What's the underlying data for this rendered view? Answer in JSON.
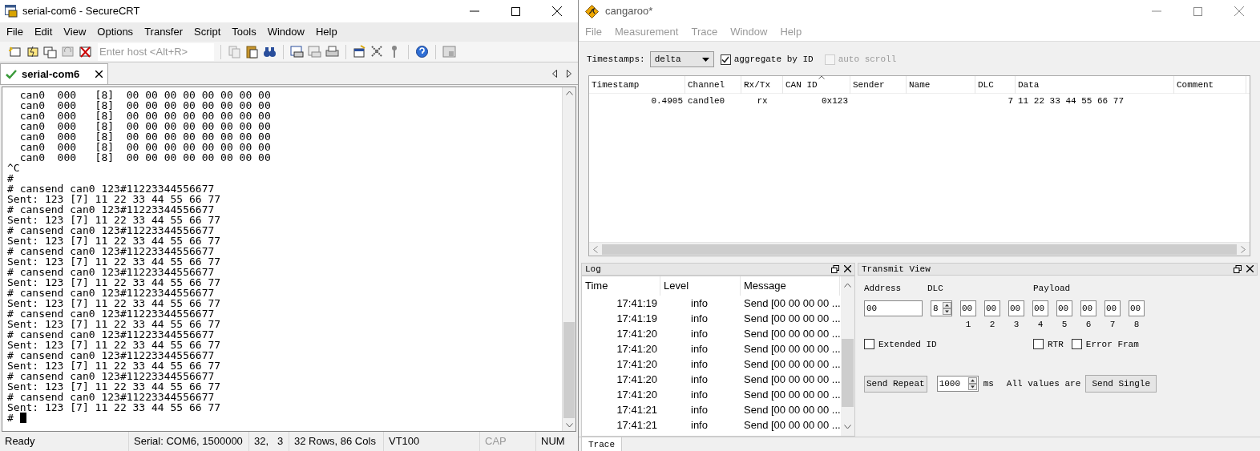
{
  "securecrt": {
    "title": "serial-com6 - SecureCRT",
    "menu": [
      {
        "label": "File"
      },
      {
        "label": "Edit"
      },
      {
        "label": "View"
      },
      {
        "label": "Options"
      },
      {
        "label": "Transfer"
      },
      {
        "label": "Script"
      },
      {
        "label": "Tools"
      },
      {
        "label": "Window"
      },
      {
        "label": "Help"
      }
    ],
    "host_placeholder": "Enter host <Alt+R>",
    "tabs": [
      {
        "label": "serial-com6",
        "selected": true
      }
    ],
    "terminal_lines": [
      "  can0  000   [8]  00 00 00 00 00 00 00 00",
      "  can0  000   [8]  00 00 00 00 00 00 00 00",
      "  can0  000   [8]  00 00 00 00 00 00 00 00",
      "  can0  000   [8]  00 00 00 00 00 00 00 00",
      "  can0  000   [8]  00 00 00 00 00 00 00 00",
      "  can0  000   [8]  00 00 00 00 00 00 00 00",
      "  can0  000   [8]  00 00 00 00 00 00 00 00",
      "^C",
      "#",
      "# cansend can0 123#11223344556677",
      "Sent: 123 [7] 11 22 33 44 55 66 77",
      "# cansend can0 123#11223344556677",
      "Sent: 123 [7] 11 22 33 44 55 66 77",
      "# cansend can0 123#11223344556677",
      "Sent: 123 [7] 11 22 33 44 55 66 77",
      "# cansend can0 123#11223344556677",
      "Sent: 123 [7] 11 22 33 44 55 66 77",
      "# cansend can0 123#11223344556677",
      "Sent: 123 [7] 11 22 33 44 55 66 77",
      "# cansend can0 123#11223344556677",
      "Sent: 123 [7] 11 22 33 44 55 66 77",
      "# cansend can0 123#11223344556677",
      "Sent: 123 [7] 11 22 33 44 55 66 77",
      "# cansend can0 123#11223344556677",
      "Sent: 123 [7] 11 22 33 44 55 66 77",
      "# cansend can0 123#11223344556677",
      "Sent: 123 [7] 11 22 33 44 55 66 77",
      "# cansend can0 123#11223344556677",
      "Sent: 123 [7] 11 22 33 44 55 66 77",
      "# cansend can0 123#11223344556677",
      "Sent: 123 [7] 11 22 33 44 55 66 77",
      "#"
    ],
    "status_bar": [
      {
        "text": "Ready",
        "active": true
      },
      {
        "text": "Serial: COM6, 1500000",
        "active": true
      },
      {
        "text": "32,   3",
        "active": true
      },
      {
        "text": "32 Rows, 86 Cols",
        "active": true
      },
      {
        "text": "VT100",
        "active": true
      },
      {
        "text": "CAP",
        "active": false
      },
      {
        "text": "NUM",
        "active": true
      }
    ]
  },
  "cangaroo": {
    "title": "cangaroo*",
    "menu": [
      {
        "label": "File",
        "disabled": true
      },
      {
        "label": "Measurement",
        "disabled": true
      },
      {
        "label": "Trace",
        "disabled": true
      },
      {
        "label": "Window",
        "disabled": true
      },
      {
        "label": "Help",
        "disabled": true
      }
    ],
    "timestamps_label": "Timestamps:",
    "timestamps_value": "delta",
    "aggregate": {
      "label": "aggregate by ID",
      "checked": true,
      "disabled": false
    },
    "auto_scroll": {
      "label": "auto scroll",
      "checked": false,
      "disabled": true
    },
    "trace_table": {
      "columns": [
        {
          "label": "Timestamp",
          "sorted": false
        },
        {
          "label": "Channel",
          "sorted": false
        },
        {
          "label": "Rx/Tx",
          "sorted": false
        },
        {
          "label": "CAN ID",
          "sorted": true
        },
        {
          "label": "Sender",
          "sorted": false
        },
        {
          "label": "Name",
          "sorted": false
        },
        {
          "label": "DLC",
          "sorted": false
        },
        {
          "label": "Data",
          "sorted": false
        },
        {
          "label": "Comment",
          "sorted": false
        }
      ],
      "rows": [
        [
          "0.4905",
          "candle0",
          "rx",
          "0x123",
          "",
          "",
          "7",
          "11 22 33 44 55 66 77",
          ""
        ]
      ]
    },
    "log": {
      "title": "Log",
      "columns": [
        "Time",
        "Level",
        "Message"
      ],
      "rows": [
        {
          "time": "17:41:19",
          "level": "info",
          "message": "Send [00 00 00 00 ..."
        },
        {
          "time": "17:41:19",
          "level": "info",
          "message": "Send [00 00 00 00 ..."
        },
        {
          "time": "17:41:20",
          "level": "info",
          "message": "Send [00 00 00 00 ..."
        },
        {
          "time": "17:41:20",
          "level": "info",
          "message": "Send [00 00 00 00 ..."
        },
        {
          "time": "17:41:20",
          "level": "info",
          "message": "Send [00 00 00 00 ..."
        },
        {
          "time": "17:41:20",
          "level": "info",
          "message": "Send [00 00 00 00 ..."
        },
        {
          "time": "17:41:20",
          "level": "info",
          "message": "Send [00 00 00 00 ..."
        },
        {
          "time": "17:41:21",
          "level": "info",
          "message": "Send [00 00 00 00 ..."
        },
        {
          "time": "17:41:21",
          "level": "info",
          "message": "Send [00 00 00 00 ..."
        }
      ]
    },
    "transmit": {
      "title": "Transmit View",
      "address_label": "Address",
      "address": "00",
      "dlc_label": "DLC",
      "dlc": "8",
      "payload_label": "Payload",
      "payload": [
        {
          "value": "00",
          "index": "1"
        },
        {
          "value": "00",
          "index": "2"
        },
        {
          "value": "00",
          "index": "3"
        },
        {
          "value": "00",
          "index": "4"
        },
        {
          "value": "00",
          "index": "5"
        },
        {
          "value": "00",
          "index": "6"
        },
        {
          "value": "00",
          "index": "7"
        },
        {
          "value": "00",
          "index": "8"
        }
      ],
      "extended_id": {
        "label": "Extended ID",
        "checked": false
      },
      "rtr": {
        "label": "RTR",
        "checked": false
      },
      "error_frame": {
        "label": "Error Fram",
        "checked": false
      },
      "send_repeat": "Send Repeat",
      "interval": "1000",
      "interval_unit": "ms",
      "hint": "All values are",
      "send_single": "Send Single"
    },
    "bottom_tabs": [
      {
        "label": "Trace",
        "selected": true
      }
    ]
  }
}
